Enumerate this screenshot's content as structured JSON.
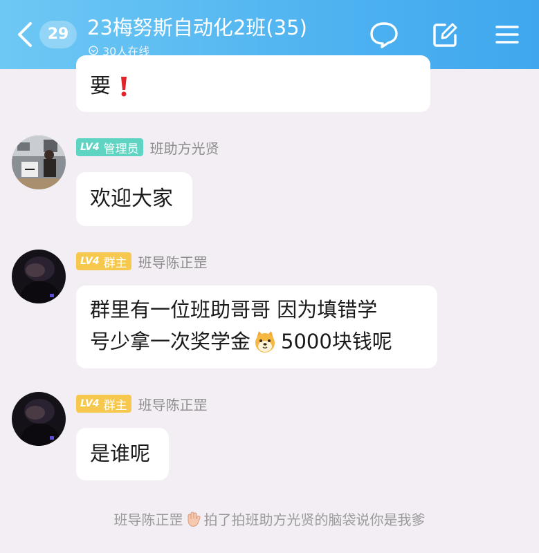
{
  "header": {
    "unread_count": "29",
    "title": "23梅努斯自动化2班(35)",
    "online": "30人在线"
  },
  "messages": [
    {
      "text": "要",
      "emoji": "heavy-exclamation-mark"
    },
    {
      "badge_level": "LV4",
      "badge_role": "管理员",
      "sender": "班助方光贤",
      "text": "欢迎大家"
    },
    {
      "badge_level": "LV4",
      "badge_role": "群主",
      "sender": "班导陈正罡",
      "line1": "群里有一位班助哥哥 因为填错学",
      "line2a": "号少拿一次奖学金",
      "line2b": "5000块钱呢",
      "emoji": "shiba-dog-face"
    },
    {
      "badge_level": "LV4",
      "badge_role": "群主",
      "sender": "班导陈正罡",
      "text": "是谁呢"
    }
  ],
  "system_notice": {
    "actor": "班导陈正罡",
    "action": "拍了拍班助方光贤的脑袋说你是我爹",
    "icon": "waving-hand"
  },
  "colors": {
    "header_start": "#6ec8f4",
    "header_end": "#3fa7ee",
    "admin_badge": "#60d4c3",
    "owner_badge": "#f6c84d",
    "background": "#f3eef4"
  }
}
